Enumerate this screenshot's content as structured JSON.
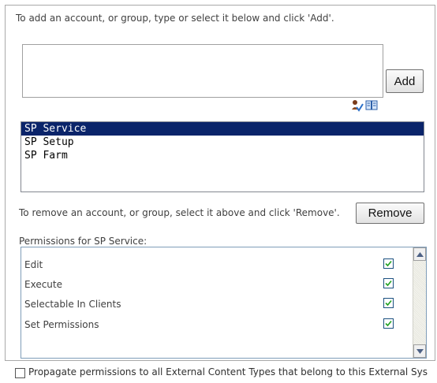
{
  "add": {
    "instruction": "To add an account, or group, type or select it below and click 'Add'.",
    "input_value": "",
    "button_label": "Add"
  },
  "icons": {
    "check_names": "check-names-icon",
    "browse": "address-book-icon"
  },
  "accounts": {
    "items": [
      "SP Service",
      "SP Setup",
      "SP Farm"
    ],
    "selected": "SP Service"
  },
  "remove": {
    "instruction": "To remove an account, or group, select it above and click 'Remove'.",
    "button_label": "Remove"
  },
  "permissions": {
    "label": "Permissions for SP Service:",
    "items": [
      {
        "label": "Edit",
        "checked": true
      },
      {
        "label": "Execute",
        "checked": true
      },
      {
        "label": "Selectable In Clients",
        "checked": true
      },
      {
        "label": "Set Permissions",
        "checked": true
      }
    ]
  },
  "propagate": {
    "label": "Propagate permissions to all External Content Types that belong to this External Sys",
    "checked": false
  },
  "colors": {
    "selection": "#0a246a",
    "checkbox_border": "#1c5180",
    "check_mark": "#21a121"
  }
}
